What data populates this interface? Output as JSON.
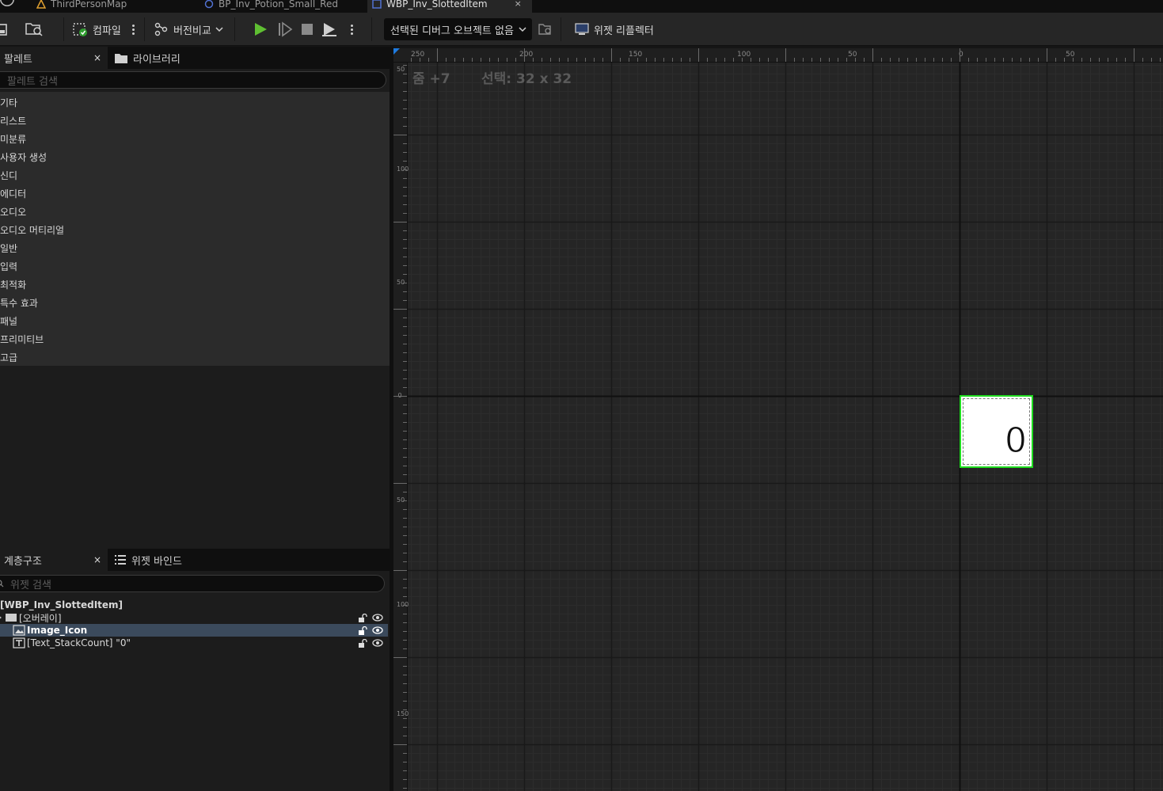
{
  "tabs": [
    {
      "label": "ThirdPersonMap",
      "icon": "level-icon"
    },
    {
      "label": "BP_Inv_Potion_Small_Red",
      "icon": "blueprint-icon"
    },
    {
      "label": "WBP_Inv_SlottedItem",
      "icon": "widget-blueprint-icon",
      "active": true,
      "close": "×"
    }
  ],
  "toolbar": {
    "compile": "컴파일",
    "diff": "버전비교",
    "debug_object": "선택된 디버그 오브젝트 없음",
    "widget_reflector": "위젯 리플렉터"
  },
  "palette": {
    "tab_label": "팔레트",
    "close": "×",
    "library_tab_label": "라이브러리",
    "search_placeholder": "팔레트 검색",
    "categories": [
      "기타",
      "리스트",
      "미분류",
      "사용자 생성",
      "신디",
      "에디터",
      "오디오",
      "오디오 머티리얼",
      "일반",
      "입력",
      "최적화",
      "특수 효과",
      "패널",
      "프리미티브",
      "고급"
    ]
  },
  "hierarchy": {
    "tab_label": "계층구조",
    "close": "×",
    "bindings_tab_label": "위젯 바인드",
    "search_placeholder": "위젯 검색",
    "root": "[WBP_Inv_SlottedItem]",
    "items": [
      "[오버레이]",
      "Image_Icon",
      "[Text_StackCount] \"0\""
    ]
  },
  "designer": {
    "zoom": "줌 +7",
    "selection": "선택: 32 x 32",
    "ruler_top": [
      "250",
      "200",
      "150",
      "100",
      "50",
      "0",
      "50"
    ],
    "ruler_left": [
      "50",
      "100",
      "50",
      "0",
      "50",
      "100",
      "150"
    ],
    "stack_count_text": "0",
    "selection_color": "#1fdc1f"
  }
}
